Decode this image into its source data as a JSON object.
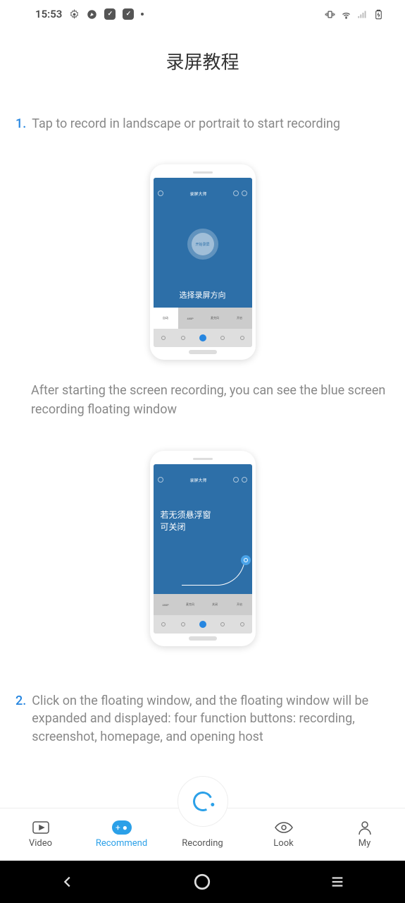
{
  "status": {
    "time": "15:53"
  },
  "page": {
    "title": "录屏教程"
  },
  "steps": [
    {
      "num": "1.",
      "text": "Tap to record in landscape or portrait to start recording"
    },
    {
      "num": "2.",
      "text": "Click on the floating window, and the floating window will be expanded and displayed: four function buttons: recording, screenshot, homepage, and opening host"
    }
  ],
  "desc1": "After starting the screen recording, you can see the blue screen recording floating window",
  "mock1": {
    "header_title": "录屏大师",
    "record_label": "开始录屏",
    "overlay": "选择录屏方向",
    "setting_480p": "480P",
    "setting_mic": "麦克风",
    "setting_open": "开启",
    "setting_auto": "自动"
  },
  "mock2": {
    "line1": "若无须悬浮窗",
    "line2": "可关闭",
    "setting_480p": "480P",
    "setting_mic": "麦克风",
    "setting_close": "关闭",
    "setting_open": "开启"
  },
  "tabs": {
    "video": "Video",
    "recommend": "Recommend",
    "recording": "Recording",
    "look": "Look",
    "my": "My"
  }
}
